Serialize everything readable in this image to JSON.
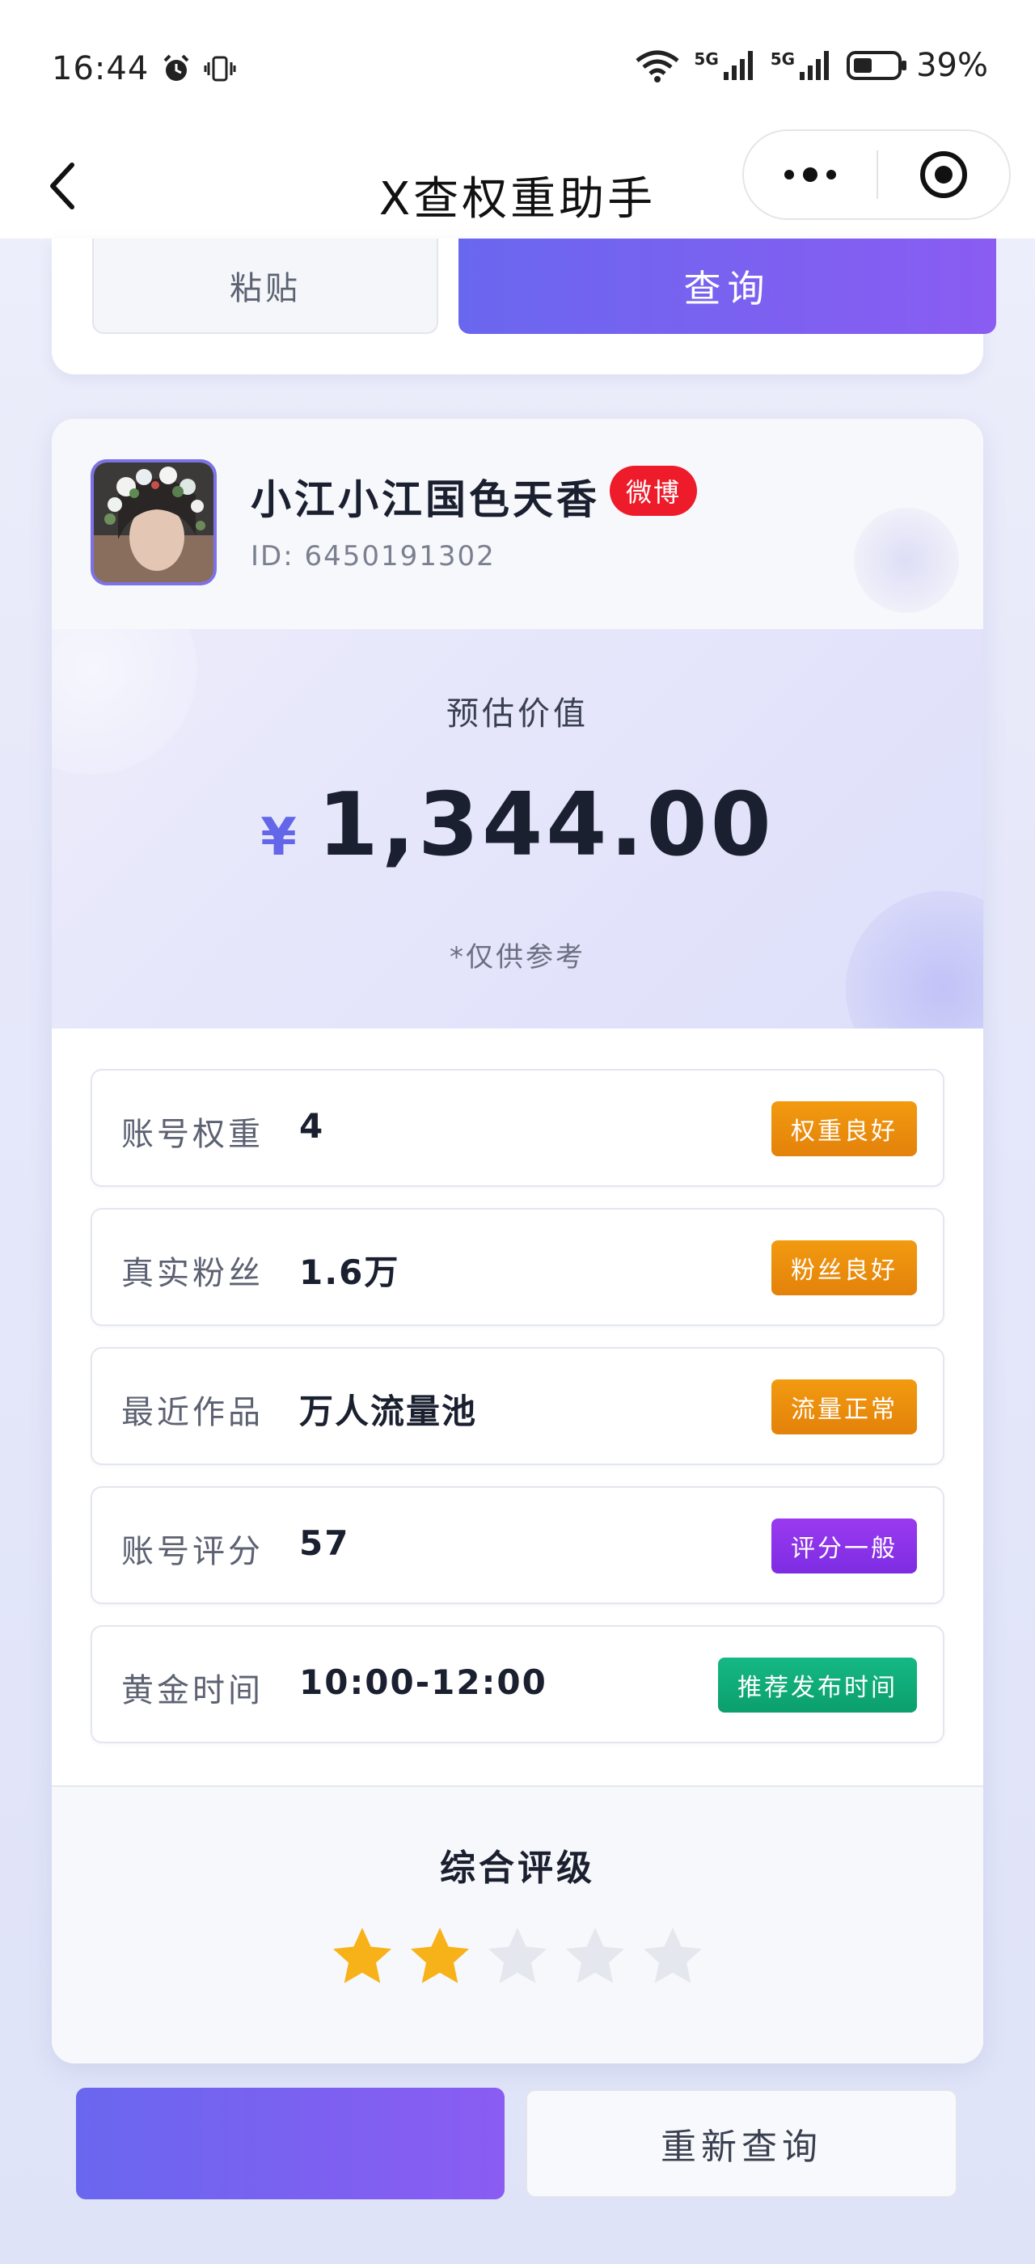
{
  "status_bar": {
    "time": "16:44",
    "battery": "39%",
    "network_1": "5G",
    "network_2": "5G"
  },
  "nav": {
    "title": "X查权重助手"
  },
  "search": {
    "paste_label": "粘贴",
    "query_label": "查询"
  },
  "profile": {
    "nickname": "小江小江国色天香",
    "platform": "微博",
    "id_label": "ID:",
    "id_value": "6450191302"
  },
  "valuation": {
    "label": "预估价值",
    "currency": "¥",
    "amount": "1,344.00",
    "note": "*仅供参考"
  },
  "metrics": [
    {
      "label": "账号权重",
      "value": "4",
      "tag": "权重良好",
      "tag_color": "#ea8a0c"
    },
    {
      "label": "真实粉丝",
      "value": "1.6万",
      "tag": "粉丝良好",
      "tag_color": "#ea8a0c"
    },
    {
      "label": "最近作品",
      "value": "万人流量池",
      "tag": "流量正常",
      "tag_color": "#ea8a0c"
    },
    {
      "label": "账号评分",
      "value": "57",
      "tag": "评分一般",
      "tag_color": "#8b33e8"
    },
    {
      "label": "黄金时间",
      "value": "10:00-12:00",
      "tag": "推荐发布时间",
      "tag_color": "#10ab79"
    }
  ],
  "rating": {
    "title": "综合评级",
    "stars_filled": 2,
    "stars_total": 5
  },
  "bottom": {
    "primary_label": "",
    "requery_label": "重新查询"
  },
  "colors": {
    "accent": "#6c63ef",
    "star_on": "#f7b21a",
    "star_off": "#e4e7ee"
  }
}
